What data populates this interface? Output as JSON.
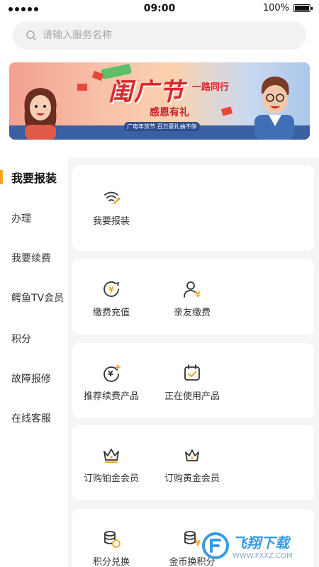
{
  "status_bar": {
    "time": "09:00",
    "battery": "100%"
  },
  "search": {
    "placeholder": "请输入服务名称"
  },
  "banner": {
    "title": "闺广节",
    "line1": "一路同行",
    "line2": "感恩有礼",
    "line3": "广电年货节 百万豪礼抽不停"
  },
  "menu": {
    "items": [
      {
        "label": "我要报装",
        "active": true
      },
      {
        "label": "办理"
      },
      {
        "label": "我要续费"
      },
      {
        "label": "鳄鱼TV会员"
      },
      {
        "label": "积分"
      },
      {
        "label": "故障报修"
      },
      {
        "label": "在线客服"
      }
    ]
  },
  "sections": [
    {
      "items": [
        {
          "label": "我要报装",
          "icon": "wifi-install-icon"
        }
      ]
    },
    {
      "items": [
        {
          "label": "缴费充值",
          "icon": "yuan-recharge-icon"
        },
        {
          "label": "亲友缴费",
          "icon": "user-yuan-icon"
        }
      ]
    },
    {
      "items": [
        {
          "label": "推荐续费产品",
          "icon": "yuan-plus-icon"
        },
        {
          "label": "正在使用产品",
          "icon": "calendar-check-icon"
        }
      ]
    },
    {
      "items": [
        {
          "label": "订购铂金会员",
          "icon": "platinum-crown-icon"
        },
        {
          "label": "订购黄金会员",
          "icon": "gold-crown-icon"
        }
      ]
    },
    {
      "items": [
        {
          "label": "积分兑换",
          "icon": "coins-exchange-icon"
        },
        {
          "label": "金币换积分",
          "icon": "coins-yuan-icon"
        }
      ]
    }
  ],
  "watermark": {
    "name": "飞翔下载",
    "url": "WWW.FXXZ.COM"
  },
  "colors": {
    "accent": "#f5a623",
    "icon_stroke": "#333333",
    "background": "#f5f5f5"
  }
}
